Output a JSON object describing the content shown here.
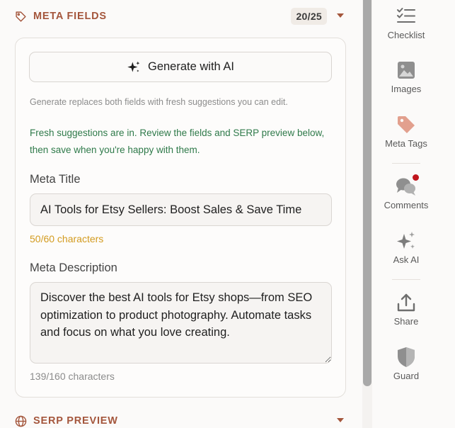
{
  "meta_fields": {
    "section_title": "META FIELDS",
    "count": "20/25",
    "generate_button_label": "Generate with AI",
    "hint_text": "Generate replaces both fields with fresh suggestions you can edit.",
    "success_message": "Fresh suggestions are in. Review the fields and SERP preview below, then save when you're happy with them.",
    "title_label": "Meta Title",
    "title_value": "AI Tools for Etsy Sellers: Boost Sales & Save Time",
    "title_counter": "50/60 characters",
    "description_label": "Meta Description",
    "description_value": "Discover the best AI tools for Etsy shops—from SEO optimization to product photography. Automate tasks and focus on what you love creating.",
    "description_counter": "139/160 characters"
  },
  "serp_preview": {
    "section_title": "SERP PREVIEW"
  },
  "rail": {
    "items": [
      {
        "label": "Checklist",
        "icon": "checklist-icon"
      },
      {
        "label": "Images",
        "icon": "image-icon"
      },
      {
        "label": "Meta Tags",
        "icon": "tag-icon"
      },
      {
        "label": "Comments",
        "icon": "comments-icon",
        "notification": true
      },
      {
        "label": "Ask AI",
        "icon": "sparkle-icon"
      },
      {
        "label": "Share",
        "icon": "share-icon"
      },
      {
        "label": "Guard",
        "icon": "shield-icon"
      }
    ]
  },
  "colors": {
    "accent": "#a4563c",
    "success": "#2f7a4a",
    "warning": "#d39b1f",
    "notification": "#c0151d",
    "tag_icon": "#e2a08e"
  }
}
